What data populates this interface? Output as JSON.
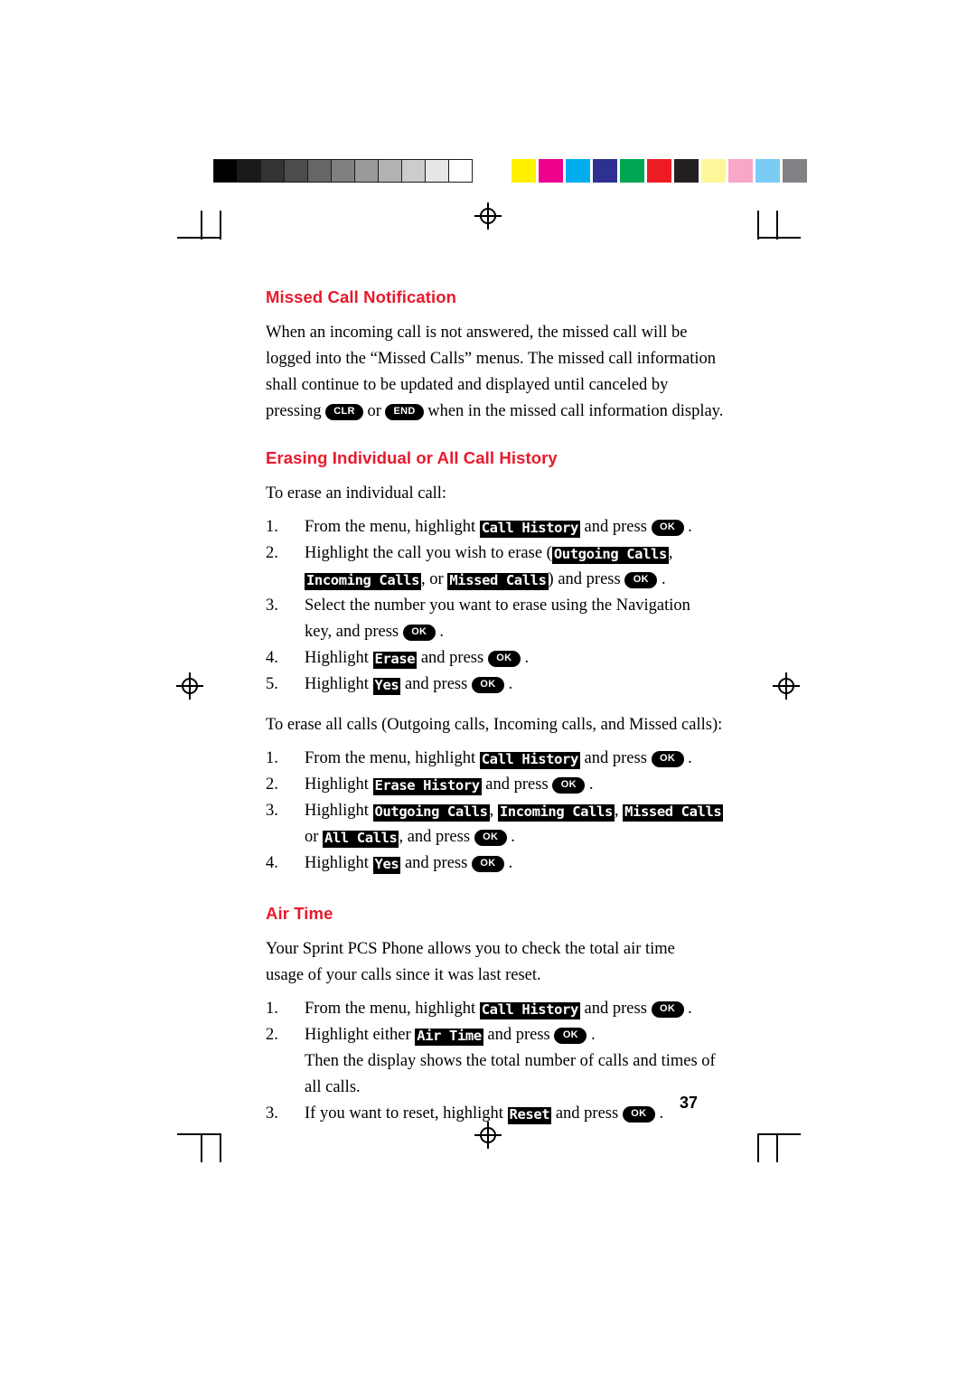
{
  "document": {
    "page_number": "37",
    "sections": [
      {
        "id": "missed-call-notification",
        "heading": "Missed Call Notification",
        "paragraph": "When an incoming call is not answered, the missed call will be logged into the “Missed Calls” menus. The missed call information shall continue to be updated and displayed until canceled by pressing"
      },
      {
        "id": "erasing-individual-or-all-call-history",
        "heading": "Erasing Individual or All Call History"
      },
      {
        "id": "air-time",
        "heading": "Air Time"
      }
    ]
  },
  "missed_call": {
    "text_1": "When an incoming call is not answered, the missed call will be",
    "text_2": "logged into the “Missed Calls” menus. The missed call information",
    "text_3": "shall continue to be updated and displayed until canceled by",
    "text_4_a": "pressing",
    "key_clr": "CLR",
    "text_4_b": "or",
    "key_end": "END",
    "text_4_c": "when in the missed call information display."
  },
  "erasing": {
    "intro": "To erase an individual call:",
    "individual_steps": [
      {
        "num": "1.",
        "parts": [
          "From the menu, highlight ",
          {
            "lcd": "Call History"
          },
          " and press ",
          {
            "key": "OK"
          },
          " ."
        ]
      },
      {
        "num": "2.",
        "parts": [
          "Highlight the call you wish to erase (",
          {
            "lcd": "Outgoing Calls"
          },
          ",",
          {
            "br": true
          },
          {
            "lcd": "Incoming Calls"
          },
          ", or ",
          {
            "lcd": "Missed Calls"
          },
          ") and press ",
          {
            "key": "OK"
          },
          " ."
        ]
      },
      {
        "num": "3.",
        "parts": [
          "Select the number you want to erase using the Navigation",
          {
            "br": true
          },
          "key, and press ",
          {
            "key": "OK"
          },
          " ."
        ]
      },
      {
        "num": "4.",
        "parts": [
          "Highlight ",
          {
            "lcd": "Erase"
          },
          " and press ",
          {
            "key": "OK"
          },
          " ."
        ]
      },
      {
        "num": "5.",
        "parts": [
          "Highlight ",
          {
            "lcd": "Yes"
          },
          " and press ",
          {
            "key": "OK"
          },
          " ."
        ]
      }
    ],
    "all_intro": "To erase all calls (Outgoing calls, Incoming calls, and Missed calls):",
    "all_steps": [
      {
        "num": "1.",
        "parts": [
          "From the menu, highlight ",
          {
            "lcd": "Call History"
          },
          " and press ",
          {
            "key": "OK"
          },
          " ."
        ]
      },
      {
        "num": "2.",
        "parts": [
          "Highlight ",
          {
            "lcd": "Erase History"
          },
          " and press ",
          {
            "key": "OK"
          },
          " ."
        ]
      },
      {
        "num": "3.",
        "parts": [
          "Highlight ",
          {
            "lcd": "Outgoing Calls"
          },
          ", ",
          {
            "lcd": "Incoming Calls"
          },
          ", ",
          {
            "lcd": "Missed Calls"
          },
          {
            "br": true
          },
          "or ",
          {
            "lcd": "All Calls"
          },
          ", and press ",
          {
            "key": "OK"
          },
          " ."
        ]
      },
      {
        "num": "4.",
        "parts": [
          "Highlight ",
          {
            "lcd": "Yes"
          },
          " and press ",
          {
            "key": "OK"
          },
          " ."
        ]
      }
    ]
  },
  "air_time": {
    "text_1": "Your Sprint PCS Phone allows you to check the total air time",
    "text_2": "usage of your calls since it was last reset.",
    "steps": [
      {
        "num": "1.",
        "parts": [
          "From the menu, highlight ",
          {
            "lcd": "Call History"
          },
          " and press ",
          {
            "key": "OK"
          },
          " ."
        ]
      },
      {
        "num": "2.",
        "parts": [
          "Highlight either ",
          {
            "lcd": "Air Time"
          },
          " and press ",
          {
            "key": "OK"
          },
          " ."
        ]
      },
      {
        "num": "",
        "parts": [
          "Then the display shows the total number of calls and times of",
          {
            "br": true
          },
          "all calls."
        ]
      },
      {
        "num": "3.",
        "parts": [
          "If you want to reset, highlight ",
          {
            "lcd": "Reset"
          },
          " and press ",
          {
            "key": "OK"
          },
          " ."
        ]
      }
    ]
  },
  "print_marks": {
    "grey_bar": [
      "#000000",
      "#1a1a1a",
      "#333333",
      "#4d4d4d",
      "#666666",
      "#808080",
      "#999999",
      "#b3b3b3",
      "#cccccc",
      "#e6e6e6",
      "#ffffff"
    ],
    "color_bar": [
      "#fff200",
      "#ec008c",
      "#00aeef",
      "#2e3192",
      "#00a651",
      "#ed1c24",
      "#231f20",
      "#fff799",
      "#f8a7c8",
      "#7accf4",
      "#808285"
    ]
  }
}
